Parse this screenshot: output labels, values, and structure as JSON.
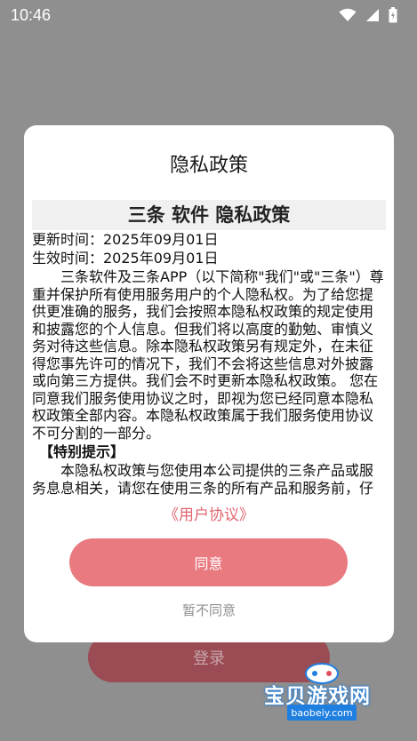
{
  "status_bar": {
    "time": "10:46"
  },
  "background": {
    "login_label": "登录"
  },
  "watermark": {
    "name": "宝贝游戏网",
    "url": "baobeiy.com"
  },
  "modal": {
    "title": "隐私政策",
    "doc_title": "三条 软件 隐私政策",
    "updated": "更新时间：2025年09月01日",
    "effective": "生效时间：2025年09月01日",
    "intro": "三条软件及三条APP（以下简称\"我们\"或\"三条\"）尊重并保护所有使用服务用户的个人隐私权。为了给您提供更准确的服务，我们会按照本隐私权政策的规定使用和披露您的个人信息。但我们将以高度的勤勉、审慎义务对待这些信息。除本隐私权政策另有规定外，在未征得您事先许可的情况下，我们不会将这些信息对外披露或向第三方提供。我们会不时更新本隐私权政策。 您在同意我们服务使用协议之时，即视为您已经同意本隐私权政策全部内容。本隐私权政策属于我们服务使用协议不可分割的一部分。",
    "special_heading": "【特别提示】",
    "special_text": "本隐私权政策与您使用本公司提供的三条产品或服务息息相关，请您在使用三条的所有产品和服务前，仔细阅读并确认您已经充分理解本政策所写明的内容。",
    "agreement_link": "《用户协议》",
    "agree": "同意",
    "disagree": "暂不同意"
  }
}
